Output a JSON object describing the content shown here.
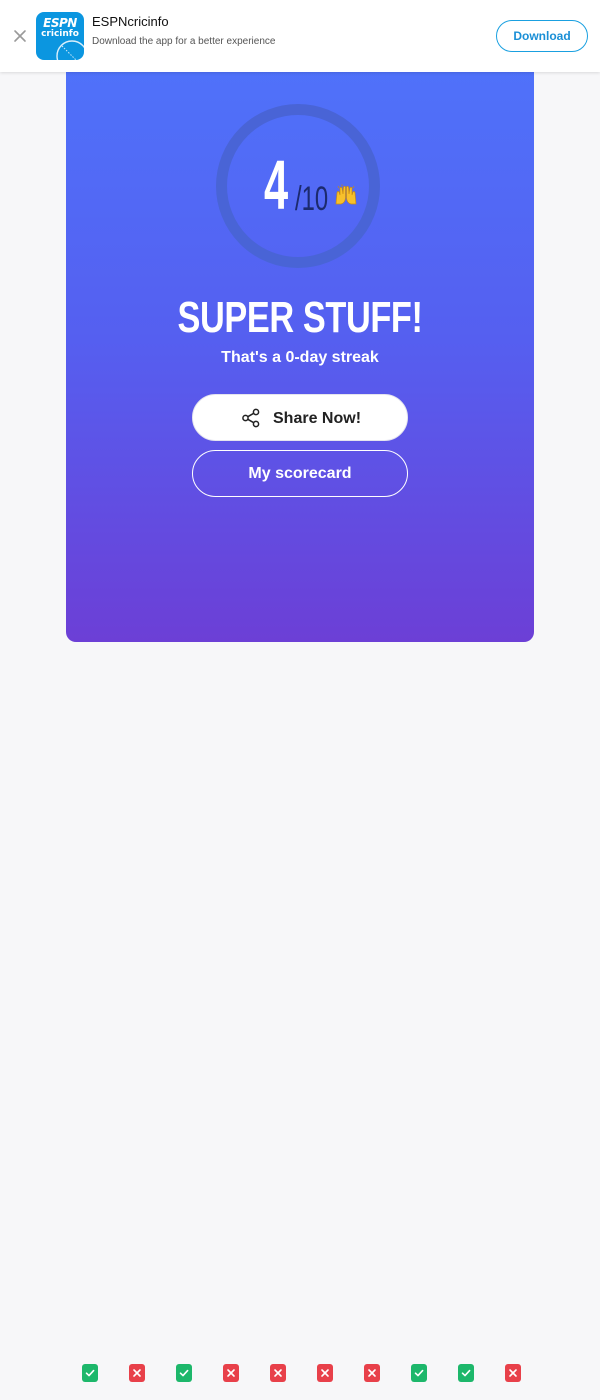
{
  "banner": {
    "close_icon": "close-icon",
    "logo_top_text": "ESPN",
    "logo_bottom_text": "cricinfo",
    "app_name": "ESPNcricinfo",
    "app_subtitle": "Download the app for a better experience",
    "download_label": "Download",
    "brand_color": "#0b96e0"
  },
  "result": {
    "score": "4",
    "total": "/10",
    "emoji_icon": "raising-hands-icon",
    "title": "SUPER STUFF!",
    "streak": "That's a 0-day streak",
    "share_icon": "share-icon",
    "share_label": "Share Now!",
    "scorecard_label": "My scorecard",
    "gradient_colors": [
      "#4f72fa",
      "#6c3fd6"
    ]
  },
  "answers": [
    {
      "correct": true
    },
    {
      "correct": false
    },
    {
      "correct": true
    },
    {
      "correct": false
    },
    {
      "correct": false
    },
    {
      "correct": false
    },
    {
      "correct": false
    },
    {
      "correct": true
    },
    {
      "correct": true
    },
    {
      "correct": false
    }
  ],
  "colors": {
    "correct": "#1db76b",
    "wrong": "#e8404a"
  }
}
